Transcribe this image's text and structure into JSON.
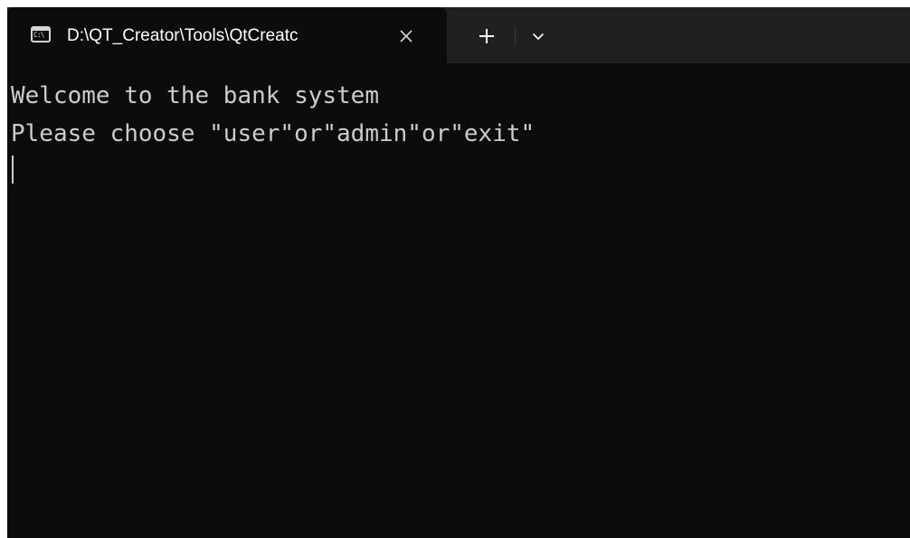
{
  "window": {
    "tab": {
      "title": "D:\\QT_Creator\\Tools\\QtCreatc",
      "icon": "console-icon",
      "icon_glyph": "C:\\"
    },
    "controls": {
      "close_icon": "close-icon",
      "new_tab_icon": "plus-icon",
      "dropdown_icon": "chevron-down-icon"
    }
  },
  "terminal": {
    "lines": [
      "Welcome to the bank system",
      "Please choose \"user\"or\"admin\"or\"exit\""
    ],
    "input": ""
  },
  "colors": {
    "background": "#0c0c0c",
    "text": "#cccccc",
    "tab_bar": "#202020",
    "tab_title": "#ffffff"
  }
}
